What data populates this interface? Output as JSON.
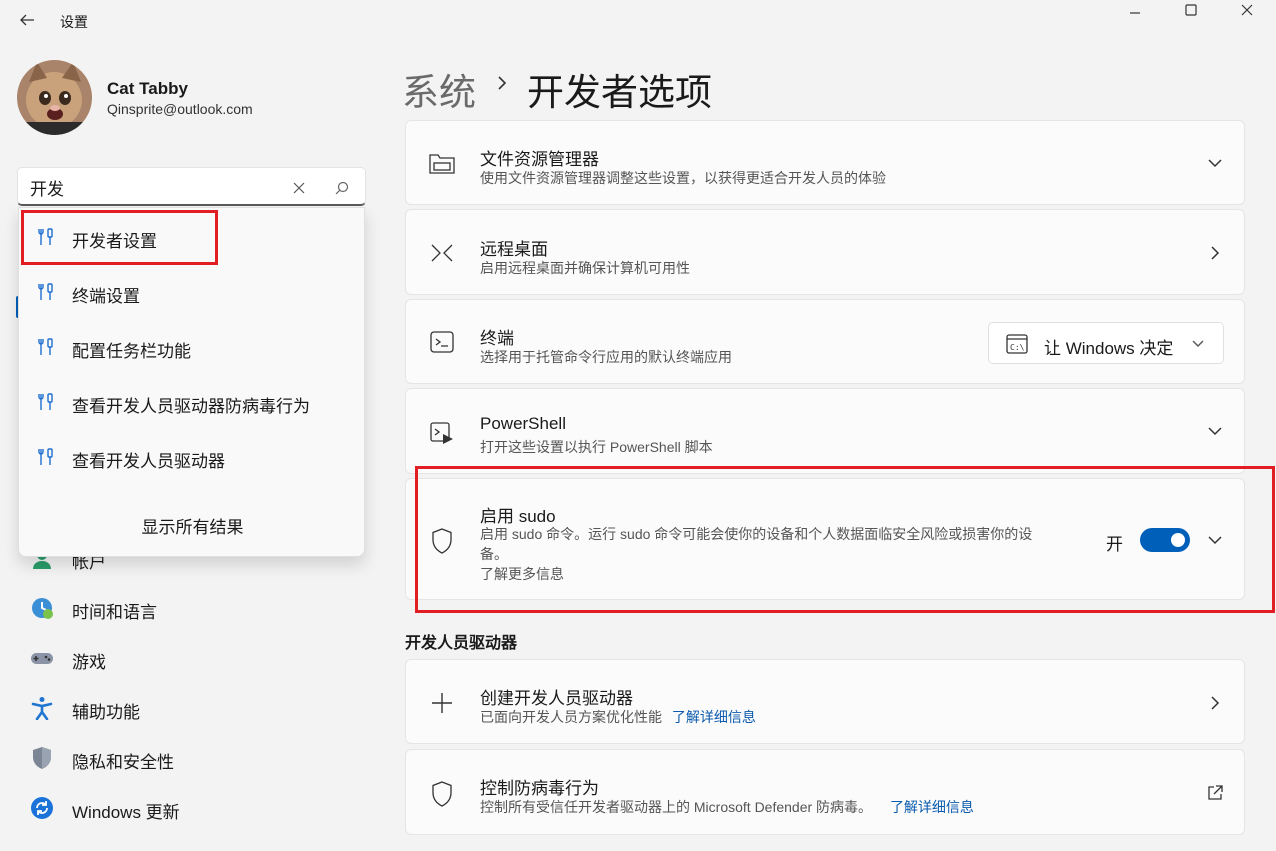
{
  "app": {
    "title": "设置"
  },
  "user": {
    "name": "Cat Tabby",
    "email": "Qinsprite@outlook.com"
  },
  "search": {
    "value": "开发",
    "placeholder": ""
  },
  "search_results": [
    {
      "label": "开发者设置",
      "icon": "wrench-screwdriver-icon"
    },
    {
      "label": "终端设置",
      "icon": "wrench-screwdriver-icon"
    },
    {
      "label": "配置任务栏功能",
      "icon": "wrench-screwdriver-icon"
    },
    {
      "label": "查看开发人员驱动器防病毒行为",
      "icon": "wrench-screwdriver-icon"
    },
    {
      "label": "查看开发人员驱动器",
      "icon": "wrench-screwdriver-icon"
    }
  ],
  "show_all": "显示所有结果",
  "nav": [
    {
      "label": "帐户",
      "icon": "accounts-icon"
    },
    {
      "label": "时间和语言",
      "icon": "time-language-icon"
    },
    {
      "label": "游戏",
      "icon": "gamepad-icon"
    },
    {
      "label": "辅助功能",
      "icon": "accessibility-icon"
    },
    {
      "label": "隐私和安全性",
      "icon": "privacy-shield-icon"
    },
    {
      "label": "Windows 更新",
      "icon": "windows-update-icon"
    }
  ],
  "breadcrumb": {
    "parent": "系统",
    "current": "开发者选项"
  },
  "cards": {
    "explorer": {
      "title": "文件资源管理器",
      "desc": "使用文件资源管理器调整这些设置，以获得更适合开发人员的体验"
    },
    "remote": {
      "title": "远程桌面",
      "desc": "启用远程桌面并确保计算机可用性"
    },
    "terminal": {
      "title": "终端",
      "desc": "选择用于托管命令行应用的默认终端应用",
      "dropdown_value": "让 Windows 决定"
    },
    "powershell": {
      "title": "PowerShell",
      "desc": "打开这些设置以执行 PowerShell 脚本"
    },
    "sudo": {
      "title": "启用 sudo",
      "desc_line1": "启用 sudo 命令。运行 sudo 命令可能会使你的设备和个人数据面临安全风险或损害你的设",
      "desc_line2": "备。",
      "link": "了解更多信息",
      "toggle_label": "开",
      "toggle_on": true
    }
  },
  "dev_drive_section": {
    "title": "开发人员驱动器",
    "create": {
      "title": "创建开发人员驱动器",
      "desc": "已面向开发人员方案优化性能",
      "link": "了解详细信息"
    },
    "antivirus": {
      "title": "控制防病毒行为",
      "desc": "控制所有受信任开发者驱动器上的 Microsoft Defender 防病毒。",
      "link": "了解详细信息"
    }
  },
  "colors": {
    "accent": "#005fb8",
    "highlight": "#e01e24",
    "link": "#0a5aad"
  }
}
